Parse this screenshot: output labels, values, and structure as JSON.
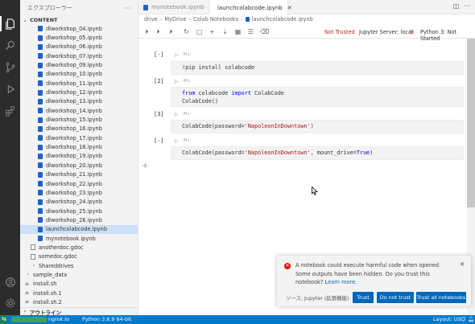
{
  "sidebar": {
    "title": "エクスプローラー",
    "more": "···",
    "section": "CONTENT",
    "files": [
      {
        "name": "dlworkshop_04.ipynb",
        "type": "nb"
      },
      {
        "name": "dlworkshop_05.ipynb",
        "type": "nb"
      },
      {
        "name": "dlworkshop_06.ipynb",
        "type": "nb"
      },
      {
        "name": "dlworkshop_07.ipynb",
        "type": "nb"
      },
      {
        "name": "dlworkshop_09.ipynb",
        "type": "nb"
      },
      {
        "name": "dlworkshop_10.ipynb",
        "type": "nb"
      },
      {
        "name": "dlworkshop_11.ipynb",
        "type": "nb"
      },
      {
        "name": "dlworkshop_12.ipynb",
        "type": "nb"
      },
      {
        "name": "dlworkshop_13.ipynb",
        "type": "nb"
      },
      {
        "name": "dlworkshop_14.ipynb",
        "type": "nb"
      },
      {
        "name": "dlworkshop_15.ipynb",
        "type": "nb"
      },
      {
        "name": "dlworkshop_16.ipynb",
        "type": "nb"
      },
      {
        "name": "dlworkshop_17.ipynb",
        "type": "nb"
      },
      {
        "name": "dlworkshop_18.ipynb",
        "type": "nb"
      },
      {
        "name": "dlworkshop_19.ipynb",
        "type": "nb"
      },
      {
        "name": "dlworkshop_20.ipynb",
        "type": "nb"
      },
      {
        "name": "dlworkshop_21.ipynb",
        "type": "nb"
      },
      {
        "name": "dlworkshop_22.ipynb",
        "type": "nb"
      },
      {
        "name": "dlworkshop_23.ipynb",
        "type": "nb"
      },
      {
        "name": "dlworkshop_24.ipynb",
        "type": "nb"
      },
      {
        "name": "dlworkshop_25.ipynb",
        "type": "nb"
      },
      {
        "name": "dlworkshop_26.ipynb",
        "type": "nb"
      },
      {
        "name": "launchcolabcode.ipynb",
        "type": "nb",
        "selected": true
      },
      {
        "name": "mynotebook.ipynb",
        "type": "nb"
      },
      {
        "name": "anotherdoc.gdoc",
        "type": "file",
        "indent": "mid"
      },
      {
        "name": "somedoc.gdoc",
        "type": "file",
        "indent": "mid"
      },
      {
        "name": "Shareddrives",
        "type": "folder",
        "indent": "mid"
      },
      {
        "name": "sample_data",
        "type": "folder",
        "indent": "low"
      },
      {
        "name": "install.sh",
        "type": "sh",
        "indent": "low"
      },
      {
        "name": "install.sh.1",
        "type": "sh",
        "indent": "low"
      },
      {
        "name": "install.sh.2",
        "type": "sh",
        "indent": "low"
      }
    ],
    "footer": "アウトライン"
  },
  "tabs": [
    {
      "label": "mynotebook.ipynb",
      "active": false
    },
    {
      "label": "launchcolabcode.ipynb",
      "active": true
    }
  ],
  "breadcrumb": [
    "drive",
    "MyDrive",
    "Colab Notebooks",
    "launchcolabcode.ipynb"
  ],
  "toolbar": {
    "not_trusted": "Not Trusted",
    "server": "Jupyter Server: local",
    "kernel": "Python 3: Not Started"
  },
  "cells": [
    {
      "status": "[-]",
      "md": "M↓",
      "code": "!pip install colabcode"
    },
    {
      "status": "[2]",
      "md": "M↓",
      "code": "from colabcode import ColabCode\nColabCode()"
    },
    {
      "status": "[3]",
      "md": "M↓",
      "code": "ColabCode(password='NapoleonInDowntown')"
    },
    {
      "status": "[-]",
      "md": "M↓",
      "code": "ColabCode(password='NapoleonInDowntown', mount_drive=True)"
    }
  ],
  "notification": {
    "message": "A notebook could execute harmful code when opened. Some outputs have been hidden. Do you trust this notebook?",
    "link": "Learn more.",
    "source": "ソース: Jupyter (拡張機能)",
    "buttons": [
      "Trust",
      "Do not trust",
      "Trust all notebooks"
    ]
  },
  "statusbar": {
    "remote": "⇆",
    "host": "ngrok.io",
    "python": "Python 3.6.9 64-bit",
    "layout": "Layout: US"
  },
  "colors": {
    "accent": "#007acc",
    "notebook_icon": "#1e63c7",
    "error": "#c42b1c"
  }
}
